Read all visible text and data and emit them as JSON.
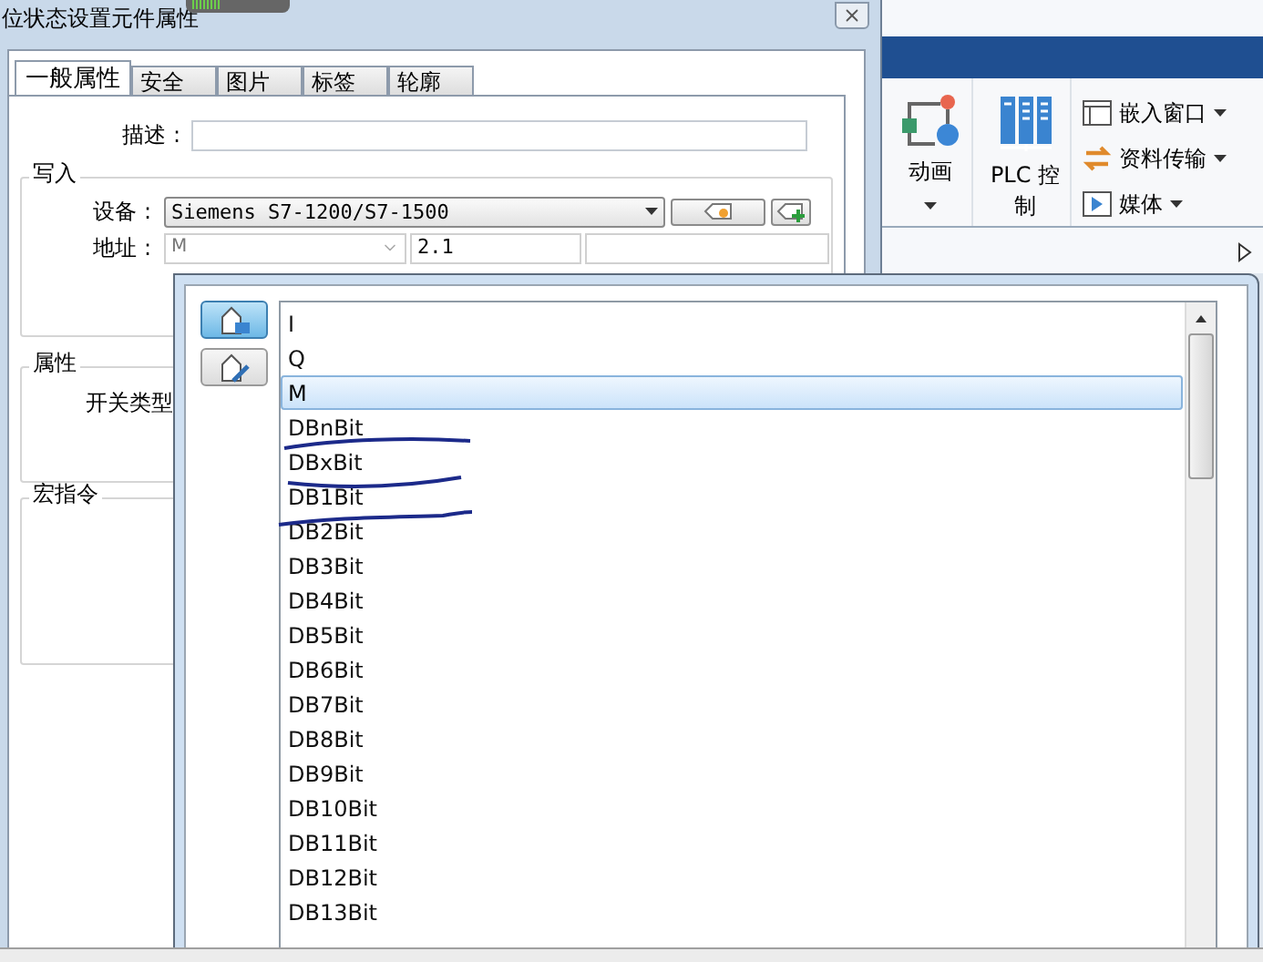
{
  "dialog": {
    "title": "位状态设置元件属性",
    "tabs": [
      {
        "label": "一般属性",
        "selected": true
      },
      {
        "label": "安全",
        "selected": false
      },
      {
        "label": "图片",
        "selected": false
      },
      {
        "label": "标签",
        "selected": false
      },
      {
        "label": "轮廓",
        "selected": false
      }
    ],
    "description_label": "描述 :",
    "write_group": {
      "title": "写入",
      "device_label": "设备 :",
      "device_value": "Siemens S7-1200/S7-1500",
      "address_label": "地址 :",
      "address_type": "M",
      "address_value": "2.1"
    },
    "properties_group": {
      "title": "属性",
      "switch_type_label": "开关类型"
    },
    "macro_group": {
      "title": "宏指令"
    }
  },
  "ribbon": {
    "large_buttons": [
      {
        "label": "动画",
        "kind": "animation",
        "dropdown": true
      },
      {
        "label": "PLC 控制",
        "kind": "plc",
        "dropdown": false
      }
    ],
    "small_buttons": [
      {
        "label": "嵌入窗口",
        "kind": "window"
      },
      {
        "label": "资料传输",
        "kind": "transfer"
      },
      {
        "label": "媒体",
        "kind": "media"
      }
    ]
  },
  "address_popup": {
    "mode_buttons": [
      {
        "kind": "tag",
        "selected": true
      },
      {
        "kind": "edit",
        "selected": false
      }
    ],
    "items": [
      {
        "label": "I",
        "selected": false
      },
      {
        "label": "Q",
        "selected": false
      },
      {
        "label": "M",
        "selected": true
      },
      {
        "label": "DBnBit",
        "selected": false
      },
      {
        "label": "DBxBit",
        "selected": false
      },
      {
        "label": "DB1Bit",
        "selected": false
      },
      {
        "label": "DB2Bit",
        "selected": false
      },
      {
        "label": "DB3Bit",
        "selected": false
      },
      {
        "label": "DB4Bit",
        "selected": false
      },
      {
        "label": "DB5Bit",
        "selected": false
      },
      {
        "label": "DB6Bit",
        "selected": false
      },
      {
        "label": "DB7Bit",
        "selected": false
      },
      {
        "label": "DB8Bit",
        "selected": false
      },
      {
        "label": "DB9Bit",
        "selected": false
      },
      {
        "label": "DB10Bit",
        "selected": false
      },
      {
        "label": "DB11Bit",
        "selected": false
      },
      {
        "label": "DB12Bit",
        "selected": false
      },
      {
        "label": "DB13Bit",
        "selected": false
      }
    ]
  }
}
